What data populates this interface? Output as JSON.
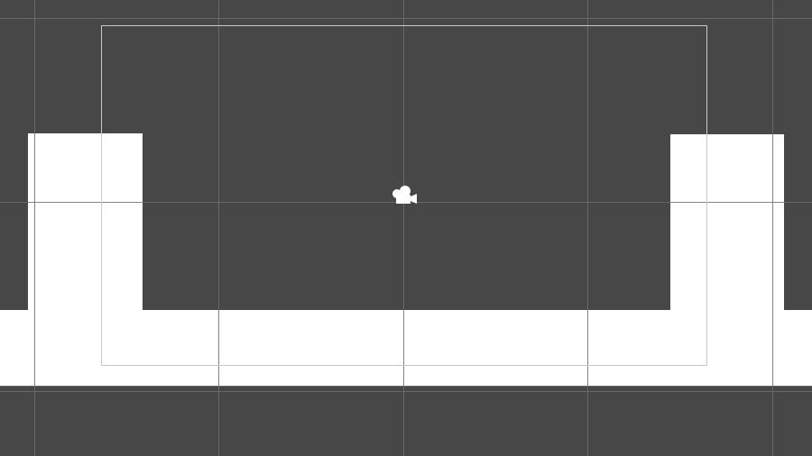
{
  "scene_view": {
    "background_color": "#474747",
    "grid_line_color": "#6e6e6e",
    "camera_frame_color": "#c8c8c8",
    "sprite_color": "#ffffff"
  },
  "objects": {
    "camera_gizmo_icon": "camera-icon",
    "left_wall": "white-block",
    "right_wall": "white-block",
    "floor": "white-block"
  }
}
